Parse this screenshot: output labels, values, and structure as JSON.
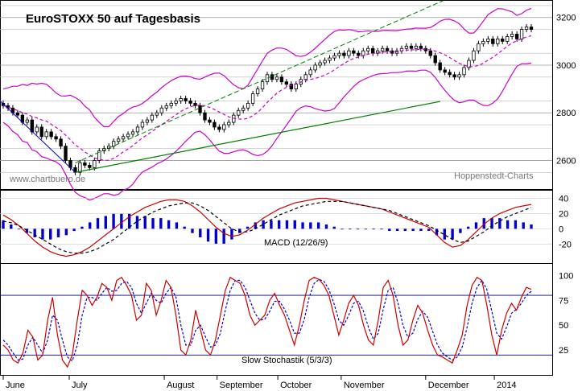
{
  "chart_data": [
    {
      "type": "candlestick",
      "title": "EuroSTOXX 50 auf Tagesbasis",
      "watermark": "www.chartbuero.de",
      "source": "Hoppenstedt-Charts",
      "y_ticks": [
        "3200",
        "3000",
        "2800",
        "2600"
      ],
      "ylim": [
        2480,
        3270
      ],
      "x_labels": [
        "June",
        "July",
        "August",
        "September",
        "October",
        "November",
        "December",
        "2014"
      ],
      "candle_color": "#000000",
      "bollinger_color": "#cc00cc",
      "trend_color": "#008000",
      "close": [
        2830,
        2820,
        2800,
        2790,
        2760,
        2770,
        2720,
        2740,
        2700,
        2720,
        2700,
        2690,
        2660,
        2600,
        2570,
        2550,
        2590,
        2580,
        2570,
        2600,
        2640,
        2650,
        2660,
        2680,
        2690,
        2700,
        2710,
        2720,
        2740,
        2760,
        2770,
        2790,
        2800,
        2820,
        2830,
        2840,
        2850,
        2860,
        2850,
        2840,
        2830,
        2800,
        2770,
        2760,
        2740,
        2730,
        2750,
        2760,
        2790,
        2810,
        2820,
        2840,
        2880,
        2900,
        2930,
        2960,
        2940,
        2950,
        2930,
        2920,
        2900,
        2920,
        2940,
        2960,
        2980,
        3000,
        3010,
        3020,
        3030,
        3040,
        3050,
        3040,
        3060,
        3050,
        3040,
        3060,
        3070,
        3050,
        3060,
        3070,
        3060,
        3050,
        3060,
        3070,
        3080,
        3070,
        3080,
        3070,
        3060,
        3040,
        3010,
        2980,
        2970,
        2960,
        2950,
        2960,
        2990,
        3020,
        3060,
        3090,
        3100,
        3110,
        3090,
        3110,
        3100,
        3120,
        3130,
        3110,
        3150,
        3160,
        3150
      ]
    },
    {
      "type": "line",
      "title": "MACD (12/26/9)",
      "y_ticks": [
        "40",
        "20",
        "0",
        "-20"
      ],
      "ylim": [
        -45,
        50
      ],
      "macd_color": "#cc0000",
      "signal_color": "#000000",
      "histogram_color": "#0000cc",
      "macd": [
        18,
        12,
        4,
        -6,
        -16,
        -24,
        -30,
        -34,
        -36,
        -34,
        -30,
        -24,
        -16,
        -8,
        0,
        8,
        16,
        22,
        28,
        32,
        36,
        38,
        38,
        36,
        30,
        22,
        12,
        2,
        -6,
        -10,
        -8,
        -2,
        6,
        14,
        20,
        26,
        30,
        34,
        36,
        38,
        40,
        40,
        38,
        36,
        34,
        32,
        30,
        28,
        26,
        22,
        18,
        14,
        10,
        6,
        2,
        -8,
        -18,
        -24,
        -22,
        -14,
        -4,
        6,
        14,
        20,
        24,
        28,
        30,
        32
      ],
      "signal": [
        10,
        8,
        4,
        -2,
        -8,
        -14,
        -20,
        -26,
        -30,
        -32,
        -32,
        -30,
        -26,
        -20,
        -14,
        -6,
        2,
        10,
        16,
        22,
        26,
        30,
        32,
        34,
        34,
        30,
        24,
        16,
        8,
        0,
        -4,
        -4,
        0,
        6,
        12,
        18,
        22,
        26,
        30,
        32,
        34,
        36,
        36,
        36,
        34,
        32,
        30,
        28,
        26,
        24,
        20,
        16,
        12,
        8,
        4,
        -2,
        -8,
        -14,
        -18,
        -16,
        -10,
        -4,
        4,
        10,
        16,
        20,
        24,
        28
      ]
    },
    {
      "type": "line",
      "title": "Slow Stochastik (5/3/3)",
      "y_ticks": [
        "100",
        "75",
        "50",
        "25"
      ],
      "ylim": [
        0,
        110
      ],
      "reference_lines": [
        80,
        20
      ],
      "k_color": "#cc0000",
      "d_color": "#0000cc",
      "k": [
        30,
        25,
        15,
        12,
        22,
        45,
        38,
        15,
        20,
        55,
        78,
        40,
        15,
        8,
        20,
        55,
        85,
        80,
        70,
        78,
        92,
        88,
        75,
        95,
        98,
        90,
        80,
        55,
        60,
        92,
        85,
        60,
        75,
        95,
        88,
        60,
        25,
        20,
        35,
        65,
        45,
        25,
        20,
        35,
        60,
        85,
        98,
        95,
        92,
        80,
        60,
        50,
        55,
        60,
        75,
        82,
        70,
        60,
        45,
        30,
        50,
        75,
        95,
        98,
        96,
        90,
        80,
        60,
        40,
        55,
        72,
        80,
        70,
        50,
        35,
        30,
        55,
        88,
        95,
        80,
        50,
        30,
        35,
        55,
        70,
        62,
        45,
        30,
        20,
        18,
        15,
        12,
        25,
        40,
        70,
        90,
        98,
        95,
        70,
        40,
        20,
        45,
        62,
        72,
        65,
        78,
        88,
        86
      ],
      "d": [
        35,
        30,
        22,
        15,
        16,
        30,
        38,
        30,
        22,
        35,
        60,
        55,
        35,
        18,
        14,
        30,
        60,
        78,
        78,
        75,
        82,
        88,
        84,
        85,
        92,
        94,
        88,
        72,
        62,
        72,
        82,
        75,
        72,
        82,
        88,
        78,
        50,
        30,
        30,
        45,
        50,
        38,
        28,
        30,
        42,
        65,
        85,
        95,
        95,
        88,
        75,
        62,
        55,
        56,
        64,
        74,
        74,
        66,
        55,
        42,
        42,
        56,
        78,
        92,
        96,
        94,
        86,
        72,
        55,
        50,
        60,
        72,
        74,
        64,
        48,
        36,
        42,
        66,
        85,
        88,
        72,
        50,
        38,
        42,
        56,
        64,
        58,
        44,
        30,
        22,
        18,
        15,
        18,
        28,
        48,
        72,
        88,
        95,
        86,
        64,
        42,
        36,
        48,
        62,
        66,
        72,
        80,
        84
      ]
    }
  ]
}
